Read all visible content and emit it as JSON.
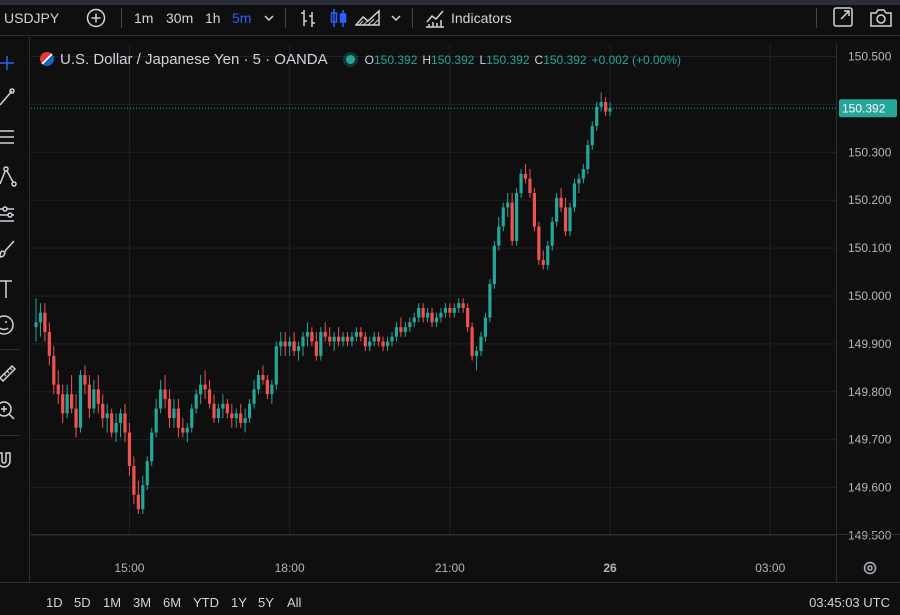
{
  "toolbar": {
    "symbol": "USDJPY",
    "intervals": [
      "1m",
      "30m",
      "1h",
      "5m"
    ],
    "active_interval": "5m",
    "indicators_label": "Indicators"
  },
  "legend": {
    "title": "U.S. Dollar / Japanese Yen · 5 · OANDA",
    "o_label": "O",
    "o": "150.392",
    "h_label": "H",
    "h": "150.392",
    "l_label": "L",
    "l": "150.392",
    "c_label": "C",
    "c": "150.392",
    "change": "+0.002 (+0.00%)"
  },
  "bottom": {
    "ranges": [
      "1D",
      "5D",
      "1M",
      "3M",
      "6M",
      "YTD",
      "1Y",
      "5Y",
      "All"
    ],
    "clock": "03:45:03 UTC"
  },
  "colors": {
    "up": "#26a69a",
    "down": "#ef5350",
    "last_price_bg": "#26a69a",
    "active_interval": "#2962ff"
  },
  "icons": {
    "add": "plus-circle-icon",
    "bars": "bar-style-icon",
    "candles": "candles-icon",
    "area": "area-style-icon",
    "indicators": "indicators-icon",
    "fullscreen": "fullscreen-icon",
    "snapshot": "camera-icon",
    "settings": "settings-icon"
  },
  "chart_data": {
    "type": "candlestick",
    "symbol": "U.S. Dollar / Japanese Yen",
    "interval": "5",
    "source": "OANDA",
    "ylim": [
      149.47,
      150.55
    ],
    "y_ticks": [
      "150.500",
      "150.400",
      "150.300",
      "150.200",
      "150.100",
      "150.000",
      "149.900",
      "149.800",
      "149.700",
      "149.600",
      "149.500"
    ],
    "x_ticks": [
      {
        "label": "15:00",
        "t": 21
      },
      {
        "label": "18:00",
        "t": 57
      },
      {
        "label": "21:00",
        "t": 93
      },
      {
        "label": "26",
        "t": 129
      },
      {
        "label": "03:00",
        "t": 165
      }
    ],
    "last_price": 150.392,
    "last_price_label": "150.392",
    "grid": true,
    "candles": [
      [
        149.935,
        149.995,
        149.905,
        149.945
      ],
      [
        149.945,
        149.985,
        149.915,
        149.965
      ],
      [
        149.965,
        149.985,
        149.905,
        149.925
      ],
      [
        149.925,
        149.945,
        149.855,
        149.875
      ],
      [
        149.875,
        149.895,
        149.795,
        149.815
      ],
      [
        149.815,
        149.845,
        149.775,
        149.795
      ],
      [
        149.795,
        149.815,
        149.735,
        149.755
      ],
      [
        149.755,
        149.815,
        149.745,
        149.795
      ],
      [
        149.795,
        149.835,
        149.755,
        149.765
      ],
      [
        149.765,
        149.795,
        149.705,
        149.725
      ],
      [
        149.725,
        149.845,
        149.715,
        149.835
      ],
      [
        149.835,
        149.855,
        149.795,
        149.815
      ],
      [
        149.815,
        149.835,
        149.745,
        149.765
      ],
      [
        149.765,
        149.825,
        149.755,
        149.805
      ],
      [
        149.805,
        149.835,
        149.755,
        149.775
      ],
      [
        149.775,
        149.795,
        149.725,
        149.745
      ],
      [
        149.745,
        149.775,
        149.715,
        149.755
      ],
      [
        149.755,
        149.765,
        149.705,
        149.715
      ],
      [
        149.715,
        149.755,
        149.695,
        149.735
      ],
      [
        149.735,
        149.765,
        149.705,
        149.755
      ],
      [
        149.755,
        149.775,
        149.695,
        149.715
      ],
      [
        149.715,
        149.735,
        149.625,
        149.645
      ],
      [
        149.645,
        149.665,
        149.565,
        149.585
      ],
      [
        149.585,
        149.615,
        149.545,
        149.555
      ],
      [
        149.555,
        149.625,
        149.545,
        149.605
      ],
      [
        149.605,
        149.665,
        149.595,
        149.655
      ],
      [
        149.655,
        149.725,
        149.645,
        149.715
      ],
      [
        149.715,
        149.785,
        149.705,
        149.765
      ],
      [
        149.765,
        149.825,
        149.755,
        149.805
      ],
      [
        149.805,
        149.835,
        149.765,
        149.785
      ],
      [
        149.785,
        149.805,
        149.725,
        149.745
      ],
      [
        149.745,
        149.785,
        149.725,
        149.765
      ],
      [
        149.765,
        149.785,
        149.705,
        149.725
      ],
      [
        149.725,
        149.745,
        149.705,
        149.715
      ],
      [
        149.715,
        149.735,
        149.695,
        149.725
      ],
      [
        149.725,
        149.775,
        149.715,
        149.765
      ],
      [
        149.765,
        149.805,
        149.755,
        149.795
      ],
      [
        149.795,
        149.835,
        149.775,
        149.815
      ],
      [
        149.815,
        149.845,
        149.785,
        149.805
      ],
      [
        149.805,
        149.825,
        149.765,
        149.775
      ],
      [
        149.775,
        149.795,
        149.735,
        149.745
      ],
      [
        149.745,
        149.775,
        149.735,
        149.765
      ],
      [
        149.765,
        149.795,
        149.745,
        149.775
      ],
      [
        149.775,
        149.785,
        149.745,
        149.755
      ],
      [
        149.755,
        149.775,
        149.725,
        149.745
      ],
      [
        149.745,
        149.765,
        149.725,
        149.755
      ],
      [
        149.755,
        149.775,
        149.725,
        149.735
      ],
      [
        149.735,
        149.765,
        149.715,
        149.745
      ],
      [
        149.745,
        149.785,
        149.735,
        149.775
      ],
      [
        149.775,
        149.825,
        149.765,
        149.805
      ],
      [
        149.805,
        149.845,
        149.795,
        149.835
      ],
      [
        149.835,
        149.855,
        149.815,
        149.825
      ],
      [
        149.825,
        149.835,
        149.785,
        149.795
      ],
      [
        149.795,
        149.825,
        149.775,
        149.815
      ],
      [
        149.815,
        149.905,
        149.805,
        149.895
      ],
      [
        149.895,
        149.925,
        149.875,
        149.905
      ],
      [
        149.905,
        149.925,
        149.875,
        149.895
      ],
      [
        149.895,
        149.915,
        149.875,
        149.905
      ],
      [
        149.905,
        149.925,
        149.875,
        149.885
      ],
      [
        149.885,
        149.905,
        149.865,
        149.895
      ],
      [
        149.895,
        149.925,
        149.875,
        149.915
      ],
      [
        149.915,
        149.945,
        149.895,
        149.925
      ],
      [
        149.925,
        149.935,
        149.895,
        149.905
      ],
      [
        149.905,
        149.925,
        149.865,
        149.875
      ],
      [
        149.875,
        149.935,
        149.865,
        149.925
      ],
      [
        149.925,
        149.945,
        149.905,
        149.915
      ],
      [
        149.915,
        149.935,
        149.895,
        149.905
      ],
      [
        149.905,
        149.925,
        149.885,
        149.915
      ],
      [
        149.915,
        149.935,
        149.895,
        149.905
      ],
      [
        149.905,
        149.925,
        149.895,
        149.915
      ],
      [
        149.915,
        149.925,
        149.895,
        149.905
      ],
      [
        149.905,
        149.925,
        149.895,
        149.915
      ],
      [
        149.915,
        149.935,
        149.905,
        149.925
      ],
      [
        149.925,
        149.935,
        149.905,
        149.915
      ],
      [
        149.915,
        149.925,
        149.885,
        149.895
      ],
      [
        149.895,
        149.915,
        149.885,
        149.905
      ],
      [
        149.905,
        149.925,
        149.895,
        149.915
      ],
      [
        149.915,
        149.925,
        149.895,
        149.905
      ],
      [
        149.905,
        149.915,
        149.885,
        149.895
      ],
      [
        149.895,
        149.915,
        149.885,
        149.905
      ],
      [
        149.905,
        149.925,
        149.895,
        149.915
      ],
      [
        149.915,
        149.945,
        149.905,
        149.935
      ],
      [
        149.935,
        149.955,
        149.915,
        149.925
      ],
      [
        149.925,
        149.945,
        149.915,
        149.935
      ],
      [
        149.935,
        149.955,
        149.925,
        149.945
      ],
      [
        149.945,
        149.965,
        149.935,
        149.955
      ],
      [
        149.955,
        149.985,
        149.945,
        149.975
      ],
      [
        149.975,
        149.985,
        149.945,
        149.955
      ],
      [
        149.955,
        149.975,
        149.945,
        149.965
      ],
      [
        149.965,
        149.975,
        149.935,
        149.945
      ],
      [
        149.945,
        149.965,
        149.935,
        149.955
      ],
      [
        149.955,
        149.975,
        149.945,
        149.965
      ],
      [
        149.965,
        149.985,
        149.955,
        149.975
      ],
      [
        149.975,
        149.985,
        149.955,
        149.965
      ],
      [
        149.965,
        149.985,
        149.955,
        149.975
      ],
      [
        149.975,
        149.995,
        149.965,
        149.985
      ],
      [
        149.985,
        149.995,
        149.965,
        149.975
      ],
      [
        149.975,
        149.985,
        149.925,
        149.935
      ],
      [
        149.935,
        149.945,
        149.865,
        149.875
      ],
      [
        149.875,
        149.895,
        149.845,
        149.885
      ],
      [
        149.885,
        149.925,
        149.875,
        149.915
      ],
      [
        149.915,
        149.965,
        149.905,
        149.955
      ],
      [
        149.955,
        150.035,
        149.945,
        150.025
      ],
      [
        150.025,
        150.115,
        150.015,
        150.105
      ],
      [
        150.105,
        150.165,
        150.095,
        150.145
      ],
      [
        150.145,
        150.195,
        150.135,
        150.185
      ],
      [
        150.185,
        150.215,
        150.165,
        150.195
      ],
      [
        150.195,
        150.215,
        150.105,
        150.115
      ],
      [
        150.115,
        150.225,
        150.105,
        150.215
      ],
      [
        150.215,
        150.265,
        150.205,
        150.255
      ],
      [
        150.255,
        150.275,
        150.235,
        150.245
      ],
      [
        150.245,
        150.265,
        150.205,
        150.215
      ],
      [
        150.215,
        150.225,
        150.135,
        150.145
      ],
      [
        150.145,
        150.155,
        150.065,
        150.075
      ],
      [
        150.075,
        150.095,
        150.055,
        150.065
      ],
      [
        150.065,
        150.115,
        150.055,
        150.105
      ],
      [
        150.105,
        150.165,
        150.095,
        150.155
      ],
      [
        150.155,
        150.215,
        150.145,
        150.205
      ],
      [
        150.205,
        150.225,
        150.175,
        150.185
      ],
      [
        150.185,
        150.205,
        150.125,
        150.135
      ],
      [
        150.135,
        150.195,
        150.125,
        150.185
      ],
      [
        150.185,
        150.245,
        150.175,
        150.235
      ],
      [
        150.235,
        150.255,
        150.215,
        150.245
      ],
      [
        150.245,
        150.275,
        150.235,
        150.265
      ],
      [
        150.265,
        150.325,
        150.255,
        150.315
      ],
      [
        150.315,
        150.365,
        150.305,
        150.355
      ],
      [
        150.355,
        150.405,
        150.345,
        150.395
      ],
      [
        150.395,
        150.425,
        150.385,
        150.405
      ],
      [
        150.405,
        150.415,
        150.375,
        150.385
      ],
      [
        150.385,
        150.405,
        150.375,
        150.392
      ]
    ]
  }
}
